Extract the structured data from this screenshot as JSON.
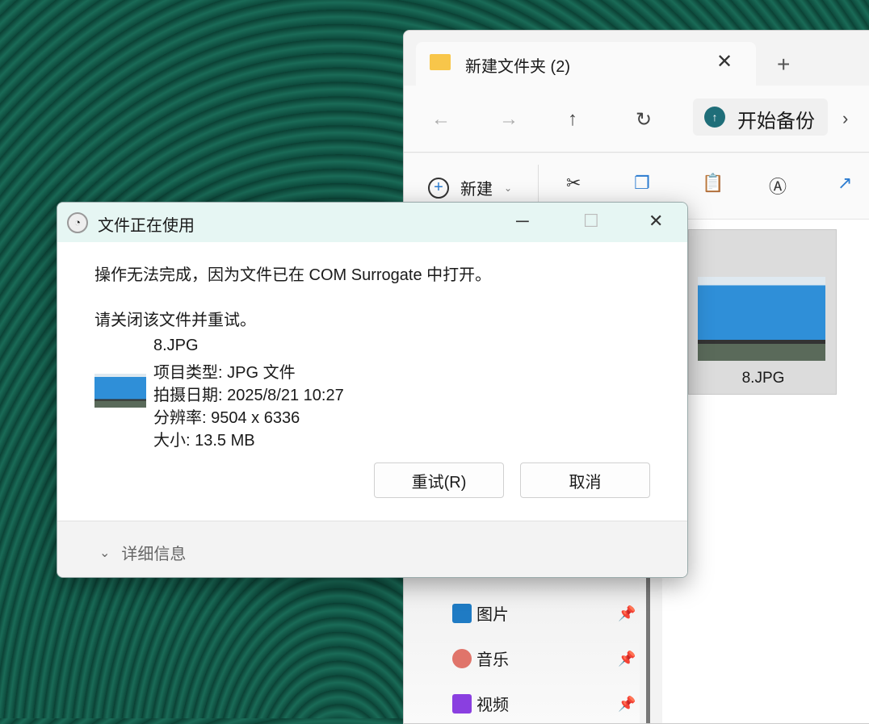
{
  "explorer": {
    "tab_title": "新建文件夹 (2)",
    "backup_label": "开始备份",
    "new_label": "新建",
    "file": {
      "name": "8.JPG"
    },
    "sidebar": [
      {
        "label": "图片",
        "icon": "pictures-icon"
      },
      {
        "label": "音乐",
        "icon": "music-icon"
      },
      {
        "label": "视频",
        "icon": "videos-icon"
      }
    ]
  },
  "dialog": {
    "title": "文件正在使用",
    "message": "操作无法完成，因为文件已在 COM Surrogate 中打开。",
    "instruction": "请关闭该文件并重试。",
    "file_name": "8.JPG",
    "item_type": "项目类型: JPG 文件",
    "date_taken": "拍摄日期: 2025/8/21 10:27",
    "resolution": "分辨率: 9504 x 6336",
    "size": "大小: 13.5 MB",
    "retry_label": "重试(R)",
    "cancel_label": "取消",
    "details_label": "详细信息"
  }
}
